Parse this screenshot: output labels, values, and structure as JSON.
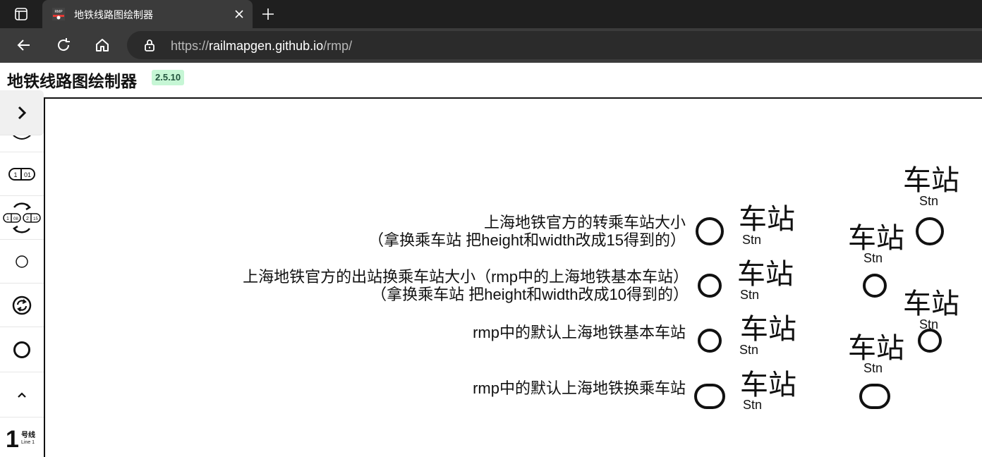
{
  "browser": {
    "tab_title": "地铁线路图绘制器",
    "url_scheme": "https://",
    "url_host": "railmapgen.github.io",
    "url_path": "/rmp/"
  },
  "app": {
    "title": "地铁线路图绘制器",
    "version": "2.5.10"
  },
  "sidebar": {
    "badge_numbers": [
      "1",
      "01"
    ],
    "badge_numbers_pair": [
      "1",
      "08",
      "2",
      "15"
    ],
    "line_badge_number": "1",
    "line_badge_zh": "号线",
    "line_badge_en": "Line 1"
  },
  "canvas": {
    "labels": {
      "official_interchange_line1": "上海地铁官方的转乘车站大小",
      "official_interchange_line2": "（拿换乘车站 把height和width改成15得到的）",
      "official_exit_line1": "上海地铁官方的出站换乘车站大小（rmp中的上海地铁基本车站）",
      "official_exit_line2": "（拿换乘车站 把height和width改成10得到的）",
      "default_basic": "rmp中的默认上海地铁基本车站",
      "default_interchange": "rmp中的默认上海地铁换乘车站"
    },
    "station_names": [
      {
        "zh": "车站",
        "en": "Stn"
      },
      {
        "zh": "车站",
        "en": "Stn"
      },
      {
        "zh": "车站",
        "en": "Stn"
      },
      {
        "zh": "车站",
        "en": "Stn"
      },
      {
        "zh": "车站",
        "en": "Stn"
      },
      {
        "zh": "车站",
        "en": "Stn"
      },
      {
        "zh": "车站",
        "en": "Stn"
      },
      {
        "zh": "车站",
        "en": "Stn"
      }
    ]
  },
  "colors": {
    "version_badge_bg": "#c6f6d5",
    "version_badge_text": "#22543d",
    "browser_chrome": "#1f1f1f"
  }
}
